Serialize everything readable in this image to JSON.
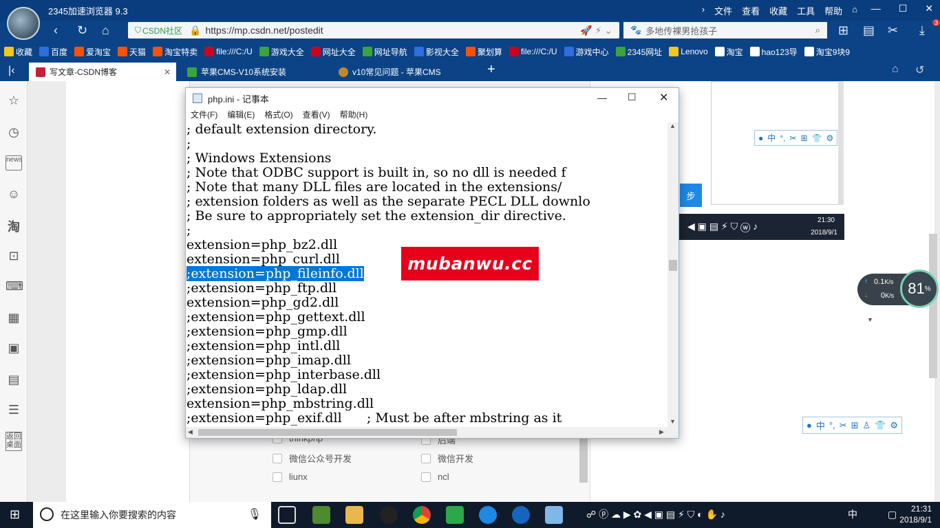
{
  "browser": {
    "title": "2345加速浏览器 9.3",
    "menu": [
      "文件",
      "查看",
      "收藏",
      "工具",
      "帮助"
    ],
    "url_prefix": "CSDN社区",
    "url": "https://mp.csdn.net/postedit",
    "search_placeholder": "多地传裸男抢孩子",
    "badge": "3",
    "bookmarks": [
      {
        "label": "收藏",
        "color": "#f5c518"
      },
      {
        "label": "百度",
        "color": "#2f6de1"
      },
      {
        "label": "爱淘宝",
        "color": "#ff5000"
      },
      {
        "label": "天猫",
        "color": "#ff5000"
      },
      {
        "label": "淘宝特卖",
        "color": "#ff5000"
      },
      {
        "label": "file:///C:/U",
        "color": "#d0021b"
      },
      {
        "label": "游戏大全",
        "color": "#3aa53a"
      },
      {
        "label": "网址大全",
        "color": "#d0021b"
      },
      {
        "label": "网址导航",
        "color": "#3aa53a"
      },
      {
        "label": "影视大全",
        "color": "#2f6de1"
      },
      {
        "label": "聚划算",
        "color": "#ff5000"
      },
      {
        "label": "file:///C:/U",
        "color": "#d0021b"
      },
      {
        "label": "游戏中心",
        "color": "#2f6de1"
      },
      {
        "label": "2345网址",
        "color": "#3aa53a"
      },
      {
        "label": "Lenovo",
        "color": "#f5c518"
      },
      {
        "label": "淘宝",
        "color": "#ffffff"
      },
      {
        "label": "hao123导",
        "color": "#ffffff"
      },
      {
        "label": "淘宝9块9",
        "color": "#ffffff"
      }
    ],
    "tabs": [
      {
        "label": "写文章-CSDN博客",
        "color": "#c32136"
      },
      {
        "label": "苹果CMS-V10系统安装",
        "color": "#3aa53a"
      },
      {
        "label": "v10常见问题 - 苹果CMS",
        "color": "#c0882c"
      }
    ],
    "sidebar_labels": {
      "back_desktop": "返回桌面"
    }
  },
  "page": {
    "checkboxes": [
      {
        "label": "thinkphp"
      },
      {
        "label": "后端"
      },
      {
        "label": "微信公众号开发"
      },
      {
        "label": "微信开发"
      },
      {
        "label": "liunx"
      },
      {
        "label": "ncl"
      }
    ],
    "next_button": "步"
  },
  "notepad": {
    "title": "php.ini - 记事本",
    "menu": [
      "文件(F)",
      "编辑(E)",
      "格式(O)",
      "查看(V)",
      "帮助(H)"
    ],
    "lines": [
      "; default extension directory.",
      ";",
      "; Windows Extensions",
      "; Note that ODBC support is built in, so no dll is needed f",
      "; Note that many DLL files are located in the extensions/",
      "; extension folders as well as the separate PECL DLL downlo",
      "; Be sure to appropriately set the extension_dir directive.",
      ";",
      "extension=php_bz2.dll",
      "extension=php_curl.dll",
      ";extension=php_fileinfo.dll",
      ";extension=php_ftp.dll",
      "extension=php_gd2.dll",
      ";extension=php_gettext.dll",
      ";extension=php_gmp.dll",
      ";extension=php_intl.dll",
      ";extension=php_imap.dll",
      ";extension=php_interbase.dll",
      ";extension=php_ldap.dll",
      "extension=php_mbstring.dll",
      ";extension=php_exif.dll      ; Must be after mbstring as it"
    ],
    "selected_line_index": 10
  },
  "watermark": "mubanwu.cc",
  "speed": {
    "up": "0.1",
    "up_unit": "K/s",
    "down": "0",
    "down_unit": "K/s",
    "percent": "81",
    "percent_unit": "%"
  },
  "tray_inset": {
    "time": "21:30",
    "date": "2018/9/1"
  },
  "taskbar": {
    "search_placeholder": "在这里输入你要搜索的内容",
    "ime": "中",
    "time": "21:31",
    "date": "2018/9/1"
  },
  "ime_toolbar": [
    "中",
    "°,",
    "⊞",
    "👕",
    "⚙"
  ]
}
